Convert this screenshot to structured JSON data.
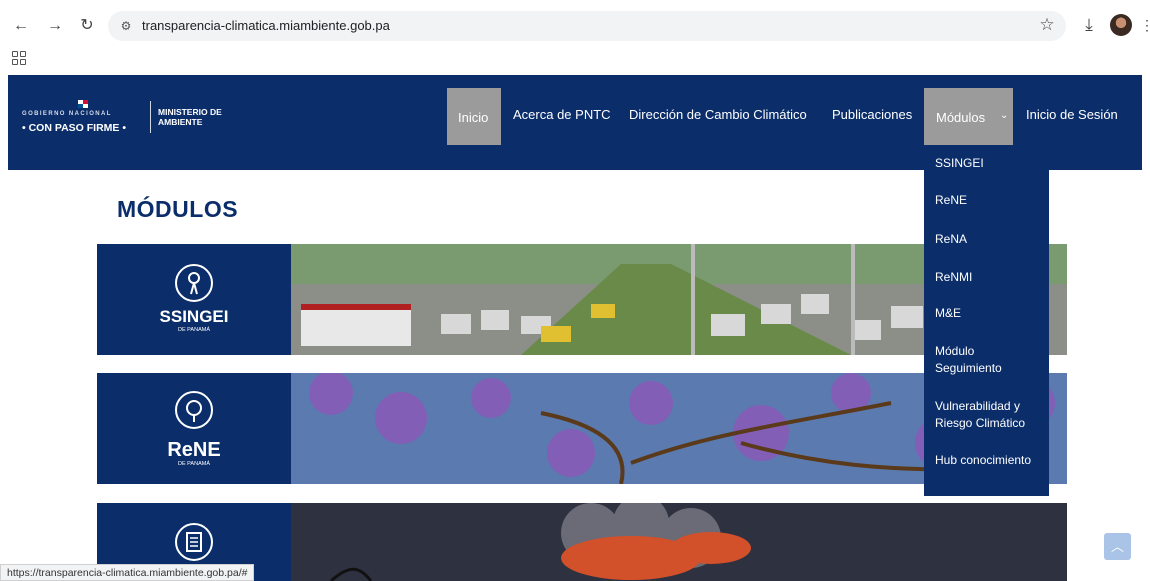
{
  "browser": {
    "url": "transparencia-climatica.miambiente.gob.pa",
    "status_url": "https://transparencia-climatica.miambiente.gob.pa/#"
  },
  "header": {
    "logo_line1": "GOBIERNO NACIONAL",
    "logo_line2": "• CON PASO FIRME •",
    "ministry": "MINISTERIO DE AMBIENTE",
    "nav": {
      "inicio": "Inicio",
      "acerca": "Acerca de PNTC",
      "direccion": "Dirección de Cambio Climático",
      "publicaciones": "Publicaciones",
      "modulos": "Módulos",
      "login": "Inicio de Sesión"
    }
  },
  "dropdown": {
    "items": [
      "SSINGEI",
      "ReNE",
      "ReNA",
      "ReNMI",
      "M&E",
      "Módulo Seguimiento",
      "Vulnerabilidad y Riesgo Climático",
      "Hub conocimiento"
    ]
  },
  "main": {
    "title": "MÓDULOS",
    "cards": [
      {
        "name": "SSINGEI",
        "sub": "DE PANAMÁ"
      },
      {
        "name": "ReNE",
        "sub": "DE PANAMÁ"
      },
      {
        "name": "",
        "sub": ""
      }
    ]
  },
  "colors": {
    "brand_navy": "#0b2e6b",
    "nav_active": "#9b9b9b"
  }
}
